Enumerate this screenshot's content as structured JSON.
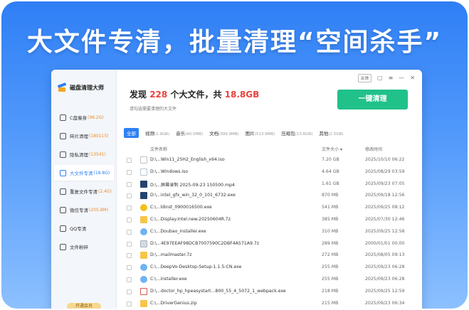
{
  "headline": "大文件专清，批量清理“空间杀手”",
  "app": {
    "name": "磁盘清理大师"
  },
  "sidebar": {
    "items": [
      {
        "label": "C盘瘦身",
        "count": "(96.2G)",
        "active": false
      },
      {
        "label": "碎片清理",
        "count": "(180115)",
        "active": false
      },
      {
        "label": "隐私清理",
        "count": "(13541)",
        "active": false
      },
      {
        "label": "大文件专清",
        "count": "(18.8G)",
        "active": true
      },
      {
        "label": "重复文件专清",
        "count": "(2.4G)",
        "active": false
      },
      {
        "label": "微信专清",
        "count": "(205.8M)",
        "active": false
      },
      {
        "label": "QQ专清",
        "count": "",
        "active": false
      },
      {
        "label": "文件粉碎",
        "count": "",
        "active": false
      }
    ],
    "vip_label": "开通会员"
  },
  "window_controls": {
    "feedback": "反馈"
  },
  "summary": {
    "prefix": "发现",
    "count": "228",
    "middle": "个大文件，共",
    "size": "18.8GB",
    "hint": "请勾选需要清理的大文件"
  },
  "clean_button": "一键清理",
  "tabs": [
    {
      "label": "全部",
      "count": "",
      "active": true
    },
    {
      "label": "视频",
      "count": "(1.9GB)",
      "active": false
    },
    {
      "label": "音乐",
      "count": "(40.0MB)",
      "active": false
    },
    {
      "label": "文档",
      "count": "(399.9MB)",
      "active": false
    },
    {
      "label": "图片",
      "count": "(513.9MB)",
      "active": false
    },
    {
      "label": "压缩包",
      "count": "(13.6GB)",
      "active": false
    },
    {
      "label": "其他",
      "count": "(2.5GB)",
      "active": false
    }
  ],
  "columns": {
    "name": "文件名称",
    "size": "文件大小",
    "date": "修改时间"
  },
  "files": [
    {
      "icon": "doc",
      "name": "D:\\...Win11_25H2_English_x64.iso",
      "size": "7.20 GB",
      "date": "2025/10/10 06:22"
    },
    {
      "icon": "doc",
      "name": "D:\\...Windows.iso",
      "size": "4.64 GB",
      "date": "2025/08/29 03:59"
    },
    {
      "icon": "dark",
      "name": "D:\\...屏幕录制 2025-09-23 150500.mp4",
      "size": "1.61 GB",
      "date": "2025/09/23 07:05"
    },
    {
      "icon": "dark",
      "name": "D:\\...intel_gfx_win_32_0_101_6732.exe",
      "size": "870 MB",
      "date": "2025/09/18 12:56"
    },
    {
      "icon": "yellow",
      "name": "C:\\...ldinst_0900016500.exe",
      "size": "541 MB",
      "date": "2025/09/25 08:12"
    },
    {
      "icon": "folder",
      "name": "C:\\...Display.Intel.new.20250604R.7z",
      "size": "385 MB",
      "date": "2025/07/30 12:46"
    },
    {
      "icon": "blue",
      "name": "C:\\...Doubao_installer.exe",
      "size": "310 MB",
      "date": "2025/09/25 12:58"
    },
    {
      "icon": "gray",
      "name": "D:\\...4E97EEAF98DCB7007590C2DBF4A571A9.7z",
      "size": "289 MB",
      "date": "2000/01/01 00:00"
    },
    {
      "icon": "folder",
      "name": "D:\\...mailmaster.7z",
      "size": "272 MB",
      "date": "2025/08/05 09:13"
    },
    {
      "icon": "blue",
      "name": "C:\\...DeepVo-Desktop-Setup-1.1.5-CN.exe",
      "size": "255 MB",
      "date": "2025/09/23 06:28"
    },
    {
      "icon": "blue",
      "name": "C:\\...installer.exe",
      "size": "255 MB",
      "date": "2025/09/23 06:28"
    },
    {
      "icon": "red",
      "name": "D:\\...doctor_hp_hpeasystart...800_55_4_5072_1_webpack.exe",
      "size": "218 MB",
      "date": "2025/09/25 12:59"
    },
    {
      "icon": "folder",
      "name": "C:\\...DriverGenius.zip",
      "size": "215 MB",
      "date": "2025/09/23 06:34"
    }
  ]
}
